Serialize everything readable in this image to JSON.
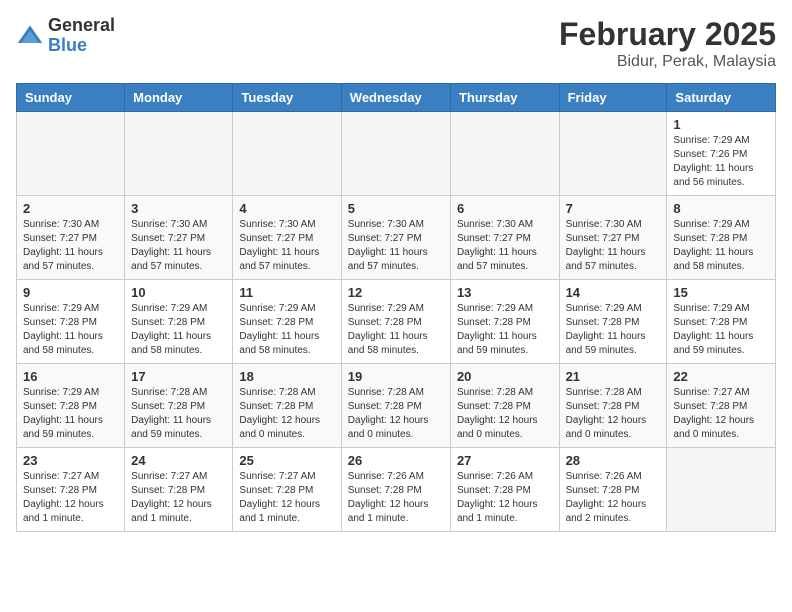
{
  "header": {
    "logo_general": "General",
    "logo_blue": "Blue",
    "month_title": "February 2025",
    "location": "Bidur, Perak, Malaysia"
  },
  "weekdays": [
    "Sunday",
    "Monday",
    "Tuesday",
    "Wednesday",
    "Thursday",
    "Friday",
    "Saturday"
  ],
  "weeks": [
    [
      {
        "day": null
      },
      {
        "day": null
      },
      {
        "day": null
      },
      {
        "day": null
      },
      {
        "day": null
      },
      {
        "day": null
      },
      {
        "day": "1",
        "sunrise": "7:29 AM",
        "sunset": "7:26 PM",
        "daylight": "11 hours and 56 minutes."
      }
    ],
    [
      {
        "day": "2",
        "sunrise": "7:30 AM",
        "sunset": "7:27 PM",
        "daylight": "11 hours and 57 minutes."
      },
      {
        "day": "3",
        "sunrise": "7:30 AM",
        "sunset": "7:27 PM",
        "daylight": "11 hours and 57 minutes."
      },
      {
        "day": "4",
        "sunrise": "7:30 AM",
        "sunset": "7:27 PM",
        "daylight": "11 hours and 57 minutes."
      },
      {
        "day": "5",
        "sunrise": "7:30 AM",
        "sunset": "7:27 PM",
        "daylight": "11 hours and 57 minutes."
      },
      {
        "day": "6",
        "sunrise": "7:30 AM",
        "sunset": "7:27 PM",
        "daylight": "11 hours and 57 minutes."
      },
      {
        "day": "7",
        "sunrise": "7:30 AM",
        "sunset": "7:27 PM",
        "daylight": "11 hours and 57 minutes."
      },
      {
        "day": "8",
        "sunrise": "7:29 AM",
        "sunset": "7:28 PM",
        "daylight": "11 hours and 58 minutes."
      }
    ],
    [
      {
        "day": "9",
        "sunrise": "7:29 AM",
        "sunset": "7:28 PM",
        "daylight": "11 hours and 58 minutes."
      },
      {
        "day": "10",
        "sunrise": "7:29 AM",
        "sunset": "7:28 PM",
        "daylight": "11 hours and 58 minutes."
      },
      {
        "day": "11",
        "sunrise": "7:29 AM",
        "sunset": "7:28 PM",
        "daylight": "11 hours and 58 minutes."
      },
      {
        "day": "12",
        "sunrise": "7:29 AM",
        "sunset": "7:28 PM",
        "daylight": "11 hours and 58 minutes."
      },
      {
        "day": "13",
        "sunrise": "7:29 AM",
        "sunset": "7:28 PM",
        "daylight": "11 hours and 59 minutes."
      },
      {
        "day": "14",
        "sunrise": "7:29 AM",
        "sunset": "7:28 PM",
        "daylight": "11 hours and 59 minutes."
      },
      {
        "day": "15",
        "sunrise": "7:29 AM",
        "sunset": "7:28 PM",
        "daylight": "11 hours and 59 minutes."
      }
    ],
    [
      {
        "day": "16",
        "sunrise": "7:29 AM",
        "sunset": "7:28 PM",
        "daylight": "11 hours and 59 minutes."
      },
      {
        "day": "17",
        "sunrise": "7:28 AM",
        "sunset": "7:28 PM",
        "daylight": "11 hours and 59 minutes."
      },
      {
        "day": "18",
        "sunrise": "7:28 AM",
        "sunset": "7:28 PM",
        "daylight": "12 hours and 0 minutes."
      },
      {
        "day": "19",
        "sunrise": "7:28 AM",
        "sunset": "7:28 PM",
        "daylight": "12 hours and 0 minutes."
      },
      {
        "day": "20",
        "sunrise": "7:28 AM",
        "sunset": "7:28 PM",
        "daylight": "12 hours and 0 minutes."
      },
      {
        "day": "21",
        "sunrise": "7:28 AM",
        "sunset": "7:28 PM",
        "daylight": "12 hours and 0 minutes."
      },
      {
        "day": "22",
        "sunrise": "7:27 AM",
        "sunset": "7:28 PM",
        "daylight": "12 hours and 0 minutes."
      }
    ],
    [
      {
        "day": "23",
        "sunrise": "7:27 AM",
        "sunset": "7:28 PM",
        "daylight": "12 hours and 1 minute."
      },
      {
        "day": "24",
        "sunrise": "7:27 AM",
        "sunset": "7:28 PM",
        "daylight": "12 hours and 1 minute."
      },
      {
        "day": "25",
        "sunrise": "7:27 AM",
        "sunset": "7:28 PM",
        "daylight": "12 hours and 1 minute."
      },
      {
        "day": "26",
        "sunrise": "7:26 AM",
        "sunset": "7:28 PM",
        "daylight": "12 hours and 1 minute."
      },
      {
        "day": "27",
        "sunrise": "7:26 AM",
        "sunset": "7:28 PM",
        "daylight": "12 hours and 1 minute."
      },
      {
        "day": "28",
        "sunrise": "7:26 AM",
        "sunset": "7:28 PM",
        "daylight": "12 hours and 2 minutes."
      },
      {
        "day": null
      }
    ]
  ],
  "labels": {
    "sunrise": "Sunrise:",
    "sunset": "Sunset:",
    "daylight": "Daylight:"
  }
}
